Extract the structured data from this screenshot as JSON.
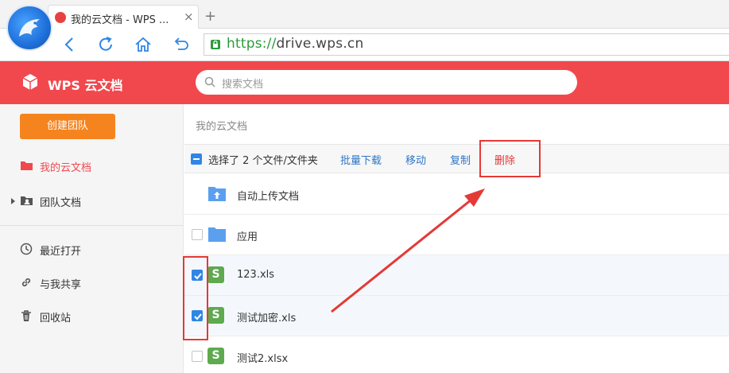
{
  "browser": {
    "tab_title": "我的云文档 - WPS ...",
    "tab_close": "×",
    "new_tab": "+",
    "url_scheme": "https://",
    "url_host": "drive.wps.cn"
  },
  "app": {
    "brand": "WPS 云文档",
    "search_placeholder": "搜索文档",
    "accent_color": "#f1484e"
  },
  "sidebar": {
    "create_team": "创建团队",
    "items": [
      {
        "label": "我的云文档",
        "icon": "folder-icon",
        "active": true
      },
      {
        "label": "团队文档",
        "icon": "team-folder-icon"
      },
      {
        "label": "最近打开",
        "icon": "clock-icon"
      },
      {
        "label": "与我共享",
        "icon": "link-icon"
      },
      {
        "label": "回收站",
        "icon": "trash-icon"
      }
    ]
  },
  "main": {
    "breadcrumb": "我的云文档",
    "toolbar": {
      "selection": "选择了 2 个文件/文件夹",
      "batch_download": "批量下载",
      "move": "移动",
      "copy": "复制",
      "delete": "删除"
    },
    "files": [
      {
        "name": "自动上传文档",
        "type": "upload-folder",
        "checked": false
      },
      {
        "name": "应用",
        "type": "folder",
        "checked": false
      },
      {
        "name": "123.xls",
        "type": "spreadsheet",
        "checked": true
      },
      {
        "name": "测试加密.xls",
        "type": "spreadsheet",
        "checked": true
      },
      {
        "name": "测试2.xlsx",
        "type": "spreadsheet",
        "checked": false
      }
    ]
  }
}
